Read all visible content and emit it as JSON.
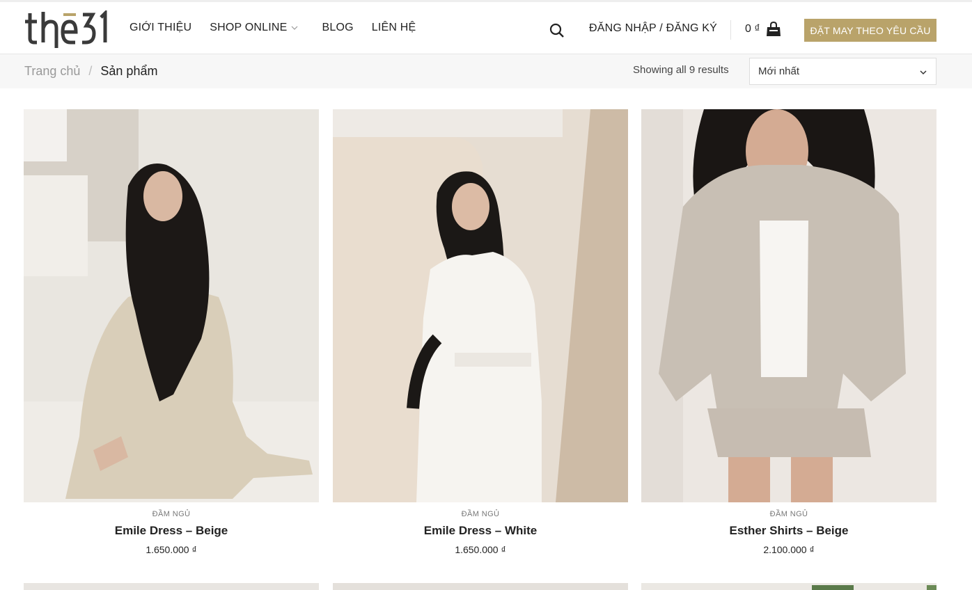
{
  "header": {
    "logo_text": "thē 31",
    "nav": [
      {
        "label": "GIỚI THIỆU"
      },
      {
        "label": "SHOP ONLINE"
      },
      {
        "label": "BLOG"
      },
      {
        "label": "LIÊN HỆ"
      }
    ],
    "login_label": "ĐĂNG NHẬP / ĐĂNG KÝ",
    "cart_amount": "0 ₫",
    "cta_label": "ĐẶT MAY THEO YÊU CẦU",
    "accent_color": "#b9a36a"
  },
  "breadcrumb": {
    "home": "Trang chủ",
    "separator": "/",
    "current": "Sản phẩm"
  },
  "results_text": "Showing all 9 results",
  "sort": {
    "selected": "Mới nhất"
  },
  "products": [
    {
      "category": "ĐẦM NGỦ",
      "name": "Emile Dress – Beige",
      "price": "1.650.000 ₫"
    },
    {
      "category": "ĐẦM NGỦ",
      "name": "Emile Dress – White",
      "price": "1.650.000 ₫"
    },
    {
      "category": "ĐẦM NGỦ",
      "name": "Esther Shirts – Beige",
      "price": "2.100.000 ₫"
    }
  ]
}
